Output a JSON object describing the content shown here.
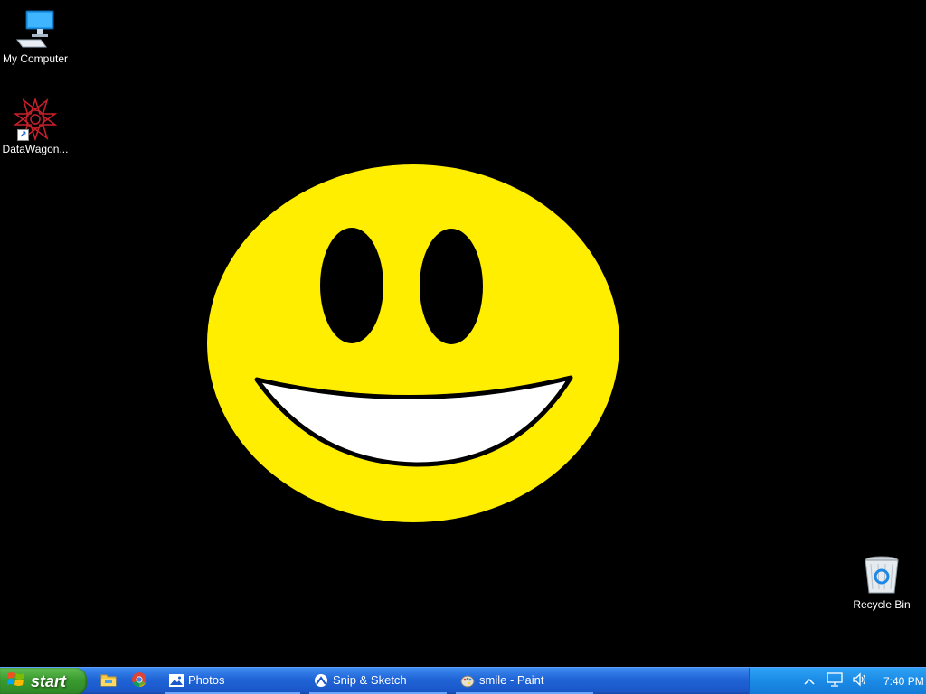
{
  "desktop": {
    "icons": [
      {
        "label": "My Computer"
      },
      {
        "label": "DataWagon..."
      },
      {
        "label": "Recycle Bin"
      }
    ]
  },
  "taskbar": {
    "start_label": "start",
    "tasks": [
      {
        "label": "Photos"
      },
      {
        "label": "Snip & Sketch"
      },
      {
        "label": "smile - Paint"
      }
    ],
    "clock": "7:40 PM"
  },
  "colors": {
    "smiley_face": "#ffee00",
    "desktop_bg": "#000000",
    "teeth": "#ffffff"
  },
  "icons": {
    "start": "windows-logo-icon",
    "quick_launch": [
      "file-explorer-icon",
      "chrome-icon"
    ],
    "tray": [
      "chevron-up-icon",
      "network-icon",
      "volume-icon"
    ]
  }
}
